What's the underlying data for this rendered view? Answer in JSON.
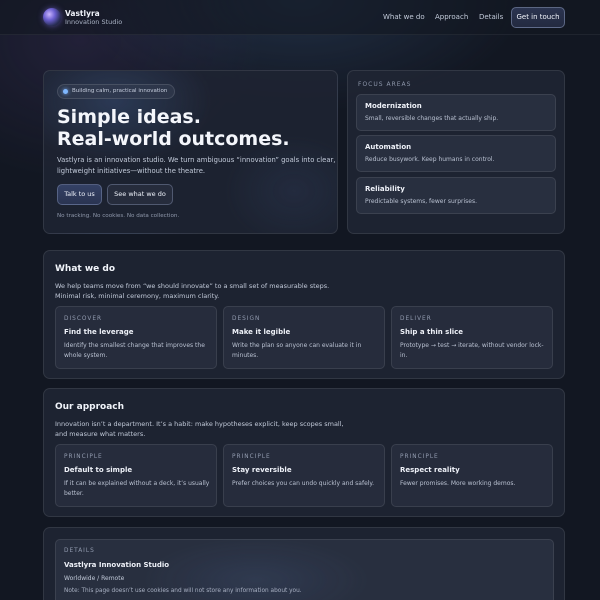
{
  "header": {
    "brand_name": "Vastlyra",
    "brand_sub": "Innovation Studio",
    "nav": [
      "What we do",
      "Approach",
      "Details"
    ],
    "cta": "Get in touch"
  },
  "hero": {
    "pill": "Building calm, practical innovation",
    "title_line1": "Simple ideas.",
    "title_line2": "Real-world outcomes.",
    "text": "Vastlyra is an innovation studio. We turn ambiguous “innovation” goals into clear, lightweight initiatives—without the theatre.",
    "primary_button": "Talk to us",
    "secondary_button": "See what we do",
    "note": "No tracking. No cookies. No data collection."
  },
  "focus": {
    "label": "FOCUS AREAS",
    "items": [
      {
        "title": "Modernization",
        "desc": "Small, reversible changes that actually ship."
      },
      {
        "title": "Automation",
        "desc": "Reduce busywork. Keep humans in control."
      },
      {
        "title": "Reliability",
        "desc": "Predictable systems, fewer surprises."
      }
    ]
  },
  "what_we_do": {
    "title": "What we do",
    "text_line1": "We help teams move from “we should innovate” to a small set of measurable steps.",
    "text_line2": "Minimal risk, minimal ceremony, maximum clarity.",
    "cards": [
      {
        "kicker": "DISCOVER",
        "title": "Find the leverage",
        "desc": "Identify the smallest change that improves the whole system."
      },
      {
        "kicker": "DESIGN",
        "title": "Make it legible",
        "desc": "Write the plan so anyone can evaluate it in minutes."
      },
      {
        "kicker": "DELIVER",
        "title": "Ship a thin slice",
        "desc": "Prototype → test → iterate, without vendor lock-in."
      }
    ]
  },
  "approach": {
    "title": "Our approach",
    "text_line1": "Innovation isn’t a department. It’s a habit: make hypotheses explicit, keep scopes small,",
    "text_line2": "and measure what matters.",
    "cards": [
      {
        "kicker": "PRINCIPLE",
        "title": "Default to simple",
        "desc": "If it can be explained without a deck, it’s usually better."
      },
      {
        "kicker": "PRINCIPLE",
        "title": "Stay reversible",
        "desc": "Prefer choices you can undo quickly and safely."
      },
      {
        "kicker": "PRINCIPLE",
        "title": "Respect reality",
        "desc": "Fewer promises. More working demos."
      }
    ]
  },
  "details": {
    "kicker": "DETAILS",
    "title": "Vastlyra Innovation Studio",
    "location": "Worldwide / Remote",
    "note": "Note: This page doesn’t use cookies and will not store any information about you."
  }
}
